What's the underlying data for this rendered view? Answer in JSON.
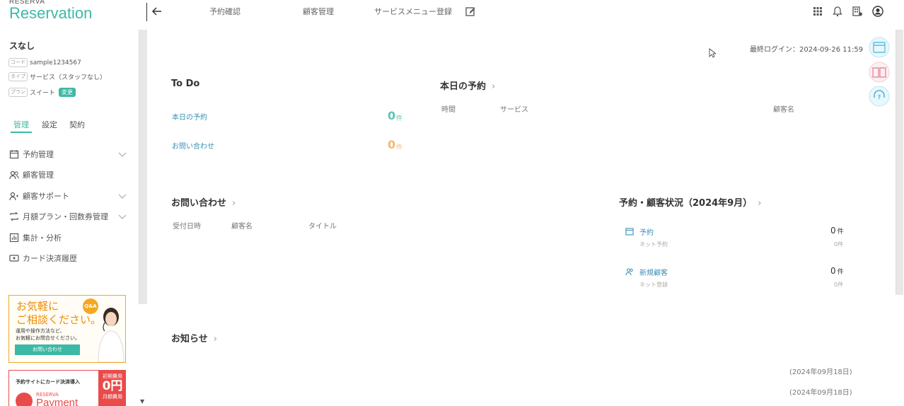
{
  "header": {
    "brand_top": "RESERVA",
    "brand_main": "Reservation",
    "nav": [
      "予約確認",
      "顧客管理",
      "サービスメニュー登録"
    ]
  },
  "sidebar": {
    "org_name": "スなし",
    "code_tag": "コード",
    "code_value": "sample1234567",
    "type_tag": "タイプ",
    "type_value": "サービス（スタッフなし）",
    "plan_tag": "プラン",
    "plan_value": "スイート",
    "plan_button": "変更",
    "tabs": [
      "管理",
      "設定",
      "契約"
    ],
    "menu": [
      {
        "label": "予約管理",
        "icon": "calendar-icon"
      },
      {
        "label": "顧客管理",
        "icon": "users-icon"
      },
      {
        "label": "顧客サポート",
        "icon": "user-support-icon"
      },
      {
        "label": "月額プラン・回数券管理",
        "icon": "repeat-icon"
      },
      {
        "label": "集計・分析",
        "icon": "chart-icon"
      },
      {
        "label": "カード決済履歴",
        "icon": "card-icon"
      }
    ],
    "banner1": {
      "title_l1": "お気軽に",
      "title_l2": "ご相談ください。",
      "sub_l1": "運用や操作方法など、",
      "sub_l2": "お気軽にお問合せください。",
      "button": "お問い合わせ",
      "badge": "Q&A"
    },
    "banner2": {
      "text": "予約サイトにカード決済導入",
      "red_l1": "初期費用",
      "red_l2": "0円",
      "red_l3": "月額費用",
      "brand": "RESERVA",
      "product": "Payment"
    }
  },
  "main": {
    "last_login": "最終ログイン：2024-09-26 11:59",
    "todo": {
      "title": "To Do",
      "items": [
        {
          "label": "本日の予約",
          "value": "0",
          "unit": "件"
        },
        {
          "label": "お問い合わせ",
          "value": "0",
          "unit": "件"
        }
      ]
    },
    "today": {
      "title": "本日の予約",
      "cols": [
        "時間",
        "サービス",
        "顧客名"
      ]
    },
    "inquiries": {
      "title": "お問い合わせ",
      "cols": [
        "受付日時",
        "顧客名",
        "タイトル"
      ]
    },
    "status": {
      "title": "予約・顧客状況（2024年9月）",
      "rows": [
        {
          "label": "予約",
          "sub": "ネット予約",
          "value": "0",
          "unit": "件",
          "subvalue": "0件"
        },
        {
          "label": "新規顧客",
          "sub": "ネット登録",
          "value": "0",
          "unit": "件",
          "subvalue": "0件"
        }
      ]
    },
    "news": {
      "title": "お知らせ",
      "dates": [
        "(2024年09月18日)",
        "(2024年09月18日)"
      ]
    }
  },
  "colors": {
    "accent": "#3cb9a5",
    "link": "#3a8fb7",
    "todo_zero_1": "#5cc5b3",
    "todo_zero_2": "#f5b96a"
  }
}
